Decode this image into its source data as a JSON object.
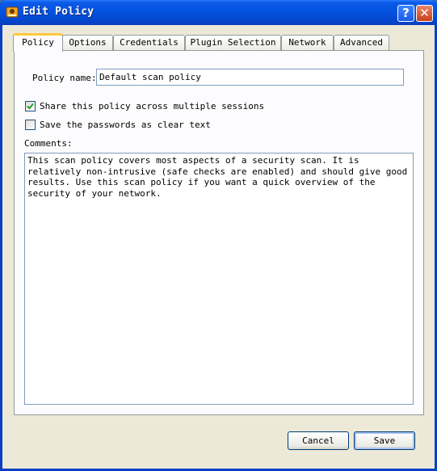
{
  "window": {
    "title": "Edit Policy",
    "help_glyph": "?",
    "close_glyph": "✕"
  },
  "tabs": [
    {
      "label": "Policy",
      "active": true
    },
    {
      "label": "Options",
      "active": false
    },
    {
      "label": "Credentials",
      "active": false
    },
    {
      "label": "Plugin Selection",
      "active": false
    },
    {
      "label": "Network",
      "active": false
    },
    {
      "label": "Advanced",
      "active": false
    }
  ],
  "policy": {
    "name_label": "Policy name:",
    "name_value": "Default scan policy",
    "share_label": "Share this policy across multiple sessions",
    "share_checked": true,
    "save_passwords_label": "Save the passwords as clear text",
    "save_passwords_checked": false,
    "comments_label": "Comments:",
    "comments_value": "This scan policy covers most aspects of a security scan. It is relatively non-intrusive (safe checks are enabled) and should give good results. Use this scan policy if you want a quick overview of the security of your network."
  },
  "buttons": {
    "cancel": "Cancel",
    "save": "Save"
  }
}
